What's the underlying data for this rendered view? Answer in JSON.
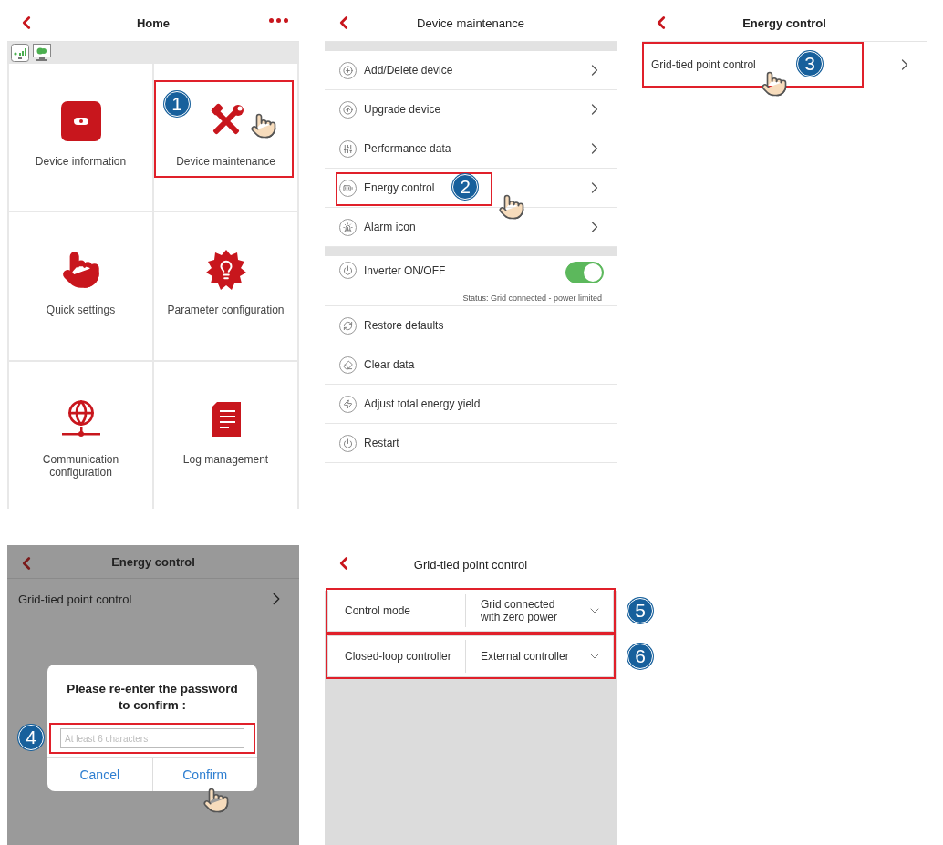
{
  "home": {
    "title": "Home",
    "tiles": [
      {
        "label": "Device information",
        "kind": "device",
        "highlighted": false
      },
      {
        "label": "Device maintenance",
        "kind": "tools",
        "highlighted": true
      },
      {
        "label": "Quick settings",
        "kind": "tap",
        "highlighted": false
      },
      {
        "label": "Parameter configuration",
        "kind": "bulb",
        "highlighted": false
      },
      {
        "label": "Communication configuration",
        "kind": "globe",
        "highlighted": false
      },
      {
        "label": "Log management",
        "kind": "log",
        "highlighted": false
      }
    ],
    "callout": "1"
  },
  "maintenance": {
    "title": "Device maintenance",
    "groups": [
      {
        "items": [
          {
            "label": "Add/Delete device",
            "kind": "link",
            "highlighted": false
          },
          {
            "label": "Upgrade device",
            "kind": "link",
            "highlighted": false
          },
          {
            "label": "Performance data",
            "kind": "link",
            "highlighted": false
          },
          {
            "label": "Energy control",
            "kind": "link",
            "highlighted": true,
            "callout": "2"
          },
          {
            "label": "Alarm icon",
            "kind": "link",
            "highlighted": false
          }
        ]
      },
      {
        "items": [
          {
            "label": "Inverter ON/OFF",
            "kind": "toggle",
            "on": true,
            "status": "Status: Grid connected - power limited"
          },
          {
            "label": "Restore defaults",
            "kind": "action"
          },
          {
            "label": "Clear data",
            "kind": "action"
          },
          {
            "label": "Adjust total energy yield",
            "kind": "action"
          },
          {
            "label": "Restart",
            "kind": "action"
          }
        ]
      }
    ]
  },
  "energy_control": {
    "title": "Energy control",
    "items": [
      {
        "label": "Grid-tied point control",
        "highlighted": true,
        "callout": "3"
      }
    ]
  },
  "password_screen": {
    "title": "Energy control",
    "item": "Grid-tied point control",
    "dialog": {
      "prompt": "Please re-enter the password to confirm :",
      "placeholder": "At least 6 characters",
      "callout": "4",
      "buttons": [
        "Cancel",
        "Confirm"
      ]
    }
  },
  "grid_control": {
    "title": "Grid-tied point control",
    "settings": [
      {
        "label": "Control mode",
        "value": "Grid connected with zero power",
        "callout": "5"
      },
      {
        "label": "Closed-loop controller",
        "value": "External controller",
        "callout": "6"
      }
    ]
  }
}
